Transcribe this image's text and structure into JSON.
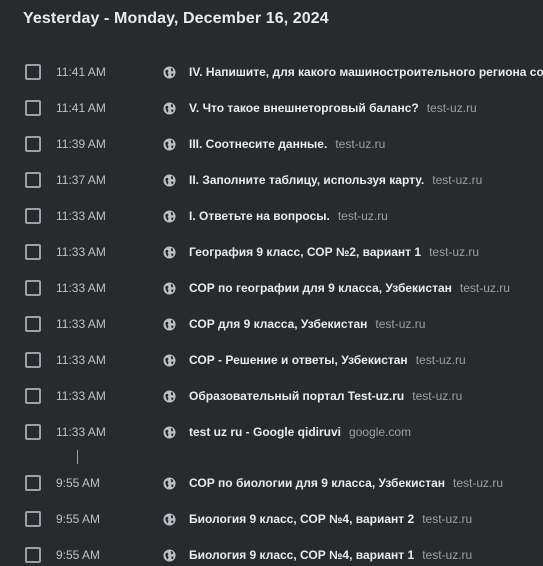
{
  "day_header": "Yesterday - Monday, December 16, 2024",
  "rows": [
    {
      "time": "11:41 AM",
      "title": "IV. Напишите, для какого машиностроительного региона соответ",
      "domain": ""
    },
    {
      "time": "11:41 AM",
      "title": "V. Что такое внешнеторговый баланс?",
      "domain": "test-uz.ru"
    },
    {
      "time": "11:39 AM",
      "title": "III. Соотнесите данные.",
      "domain": "test-uz.ru"
    },
    {
      "time": "11:37 AM",
      "title": "II. Заполните таблицу, используя карту.",
      "domain": "test-uz.ru"
    },
    {
      "time": "11:33 AM",
      "title": "I. Ответьте на вопросы.",
      "domain": "test-uz.ru"
    },
    {
      "time": "11:33 AM",
      "title": "География 9 класс, СОР №2, вариант 1",
      "domain": "test-uz.ru"
    },
    {
      "time": "11:33 AM",
      "title": "СОР по географии для 9 класса, Узбекистан",
      "domain": "test-uz.ru"
    },
    {
      "time": "11:33 AM",
      "title": "СОР для 9 класса, Узбекистан",
      "domain": "test-uz.ru"
    },
    {
      "time": "11:33 AM",
      "title": "СОР - Решение и ответы, Узбекистан",
      "domain": "test-uz.ru"
    },
    {
      "time": "11:33 AM",
      "title": "Образовательный портал Test-uz.ru",
      "domain": "test-uz.ru"
    },
    {
      "time": "11:33 AM",
      "title": "test uz ru - Google qidiruvi",
      "domain": "google.com"
    },
    {
      "time": "9:55 AM",
      "title": "СОР по биологии для 9 класса, Узбекистан",
      "domain": "test-uz.ru"
    },
    {
      "time": "9:55 AM",
      "title": "Биология 9 класс, СОР №4, вариант 2",
      "domain": "test-uz.ru"
    },
    {
      "time": "9:55 AM",
      "title": "Биология 9 класс, СОР №4, вариант 1",
      "domain": "test-uz.ru"
    }
  ],
  "colors": {
    "background": "#292a2d",
    "text_primary": "#e8eaed",
    "text_secondary": "#9aa0a6",
    "checkbox_border": "#9aa0a6"
  },
  "icons": {
    "favicon": "globe-icon",
    "gap_separator": "vertical-line"
  }
}
